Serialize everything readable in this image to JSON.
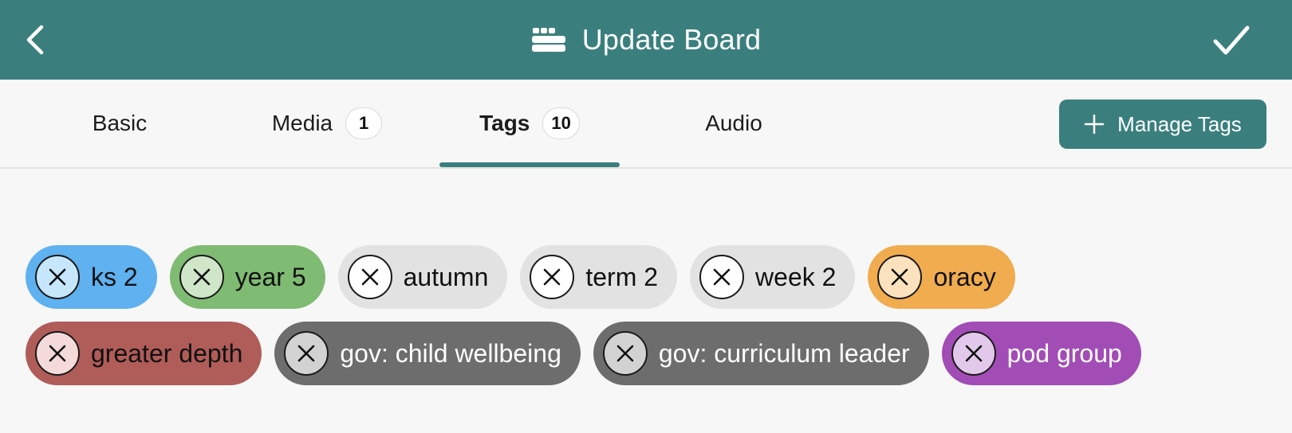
{
  "header": {
    "title": "Update Board",
    "back_icon": "chevron-left-icon",
    "title_icon": "board-icon",
    "confirm_icon": "checkmark-icon"
  },
  "tabs": [
    {
      "label": "Basic",
      "badge": null,
      "active": false
    },
    {
      "label": "Media",
      "badge": "1",
      "active": false
    },
    {
      "label": "Tags",
      "badge": "10",
      "active": true
    },
    {
      "label": "Audio",
      "badge": null,
      "active": false
    }
  ],
  "manage_tags": {
    "label": "Manage Tags",
    "icon": "plus-icon"
  },
  "tags": [
    [
      {
        "label": "ks 2",
        "bg": "#5fb1f0",
        "circle": "#c6e6fb",
        "text": "#111111"
      },
      {
        "label": "year 5",
        "bg": "#80bb73",
        "circle": "#cfe6c9",
        "text": "#111111"
      },
      {
        "label": "autumn",
        "bg": "#e2e2e2",
        "circle": "#ffffff",
        "text": "#111111"
      },
      {
        "label": "term 2",
        "bg": "#e2e2e2",
        "circle": "#ffffff",
        "text": "#111111"
      },
      {
        "label": "week 2",
        "bg": "#e2e2e2",
        "circle": "#ffffff",
        "text": "#111111"
      },
      {
        "label": "oracy",
        "bg": "#f1ac4f",
        "circle": "#fbe1bd",
        "text": "#111111"
      }
    ],
    [
      {
        "label": "greater depth",
        "bg": "#b05c58",
        "circle": "#f4dbda",
        "text": "#111111"
      },
      {
        "label": "gov: child wellbeing",
        "bg": "#6d6d6d",
        "circle": "#d2d2d2",
        "text": "#ffffff"
      },
      {
        "label": "gov: curriculum leader",
        "bg": "#6d6d6d",
        "circle": "#d2d2d2",
        "text": "#ffffff"
      },
      {
        "label": "pod group",
        "bg": "#a24cb6",
        "circle": "#e2c8ea",
        "text": "#ffffff"
      }
    ]
  ],
  "colors": {
    "accent": "#3a7f7e",
    "background": "#f7f7f7"
  }
}
